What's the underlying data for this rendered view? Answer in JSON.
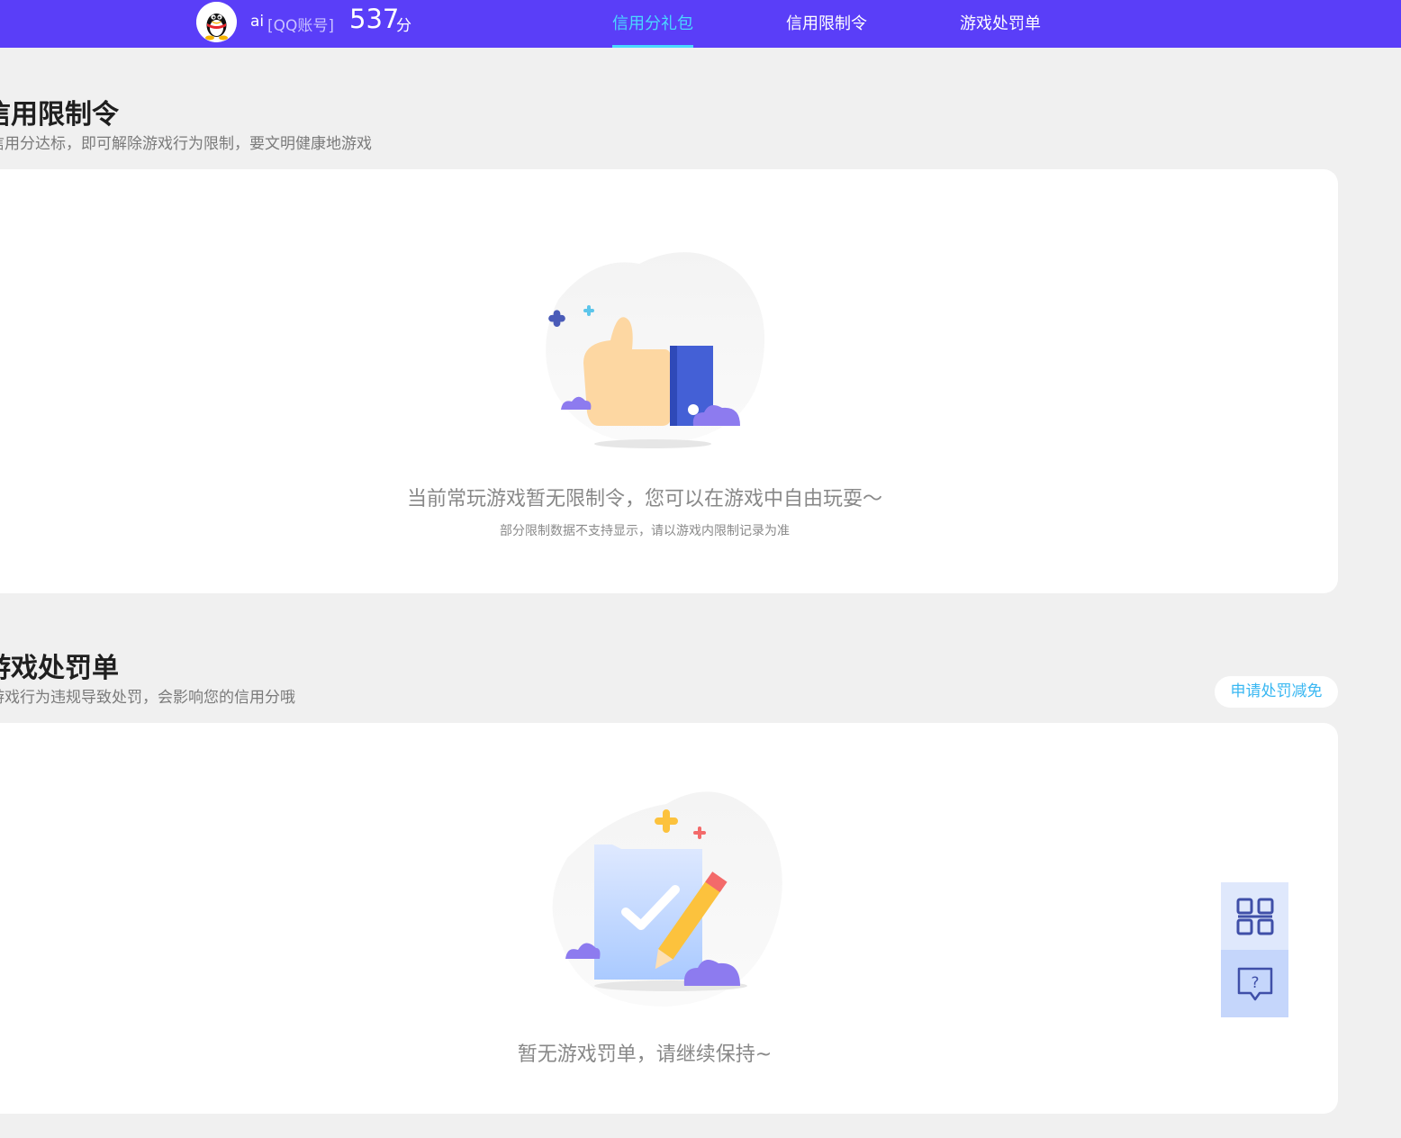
{
  "header": {
    "user_name": "ai",
    "account_type": "[QQ账号]",
    "score": "537",
    "score_unit": "分",
    "nav": [
      {
        "label": "信用分礼包",
        "active": true
      },
      {
        "label": "信用限制令",
        "active": false
      },
      {
        "label": "游戏处罚单",
        "active": false
      }
    ]
  },
  "restriction": {
    "title": "信用限制令",
    "desc": "信用分达标，即可解除游戏行为限制，要文明健康地游戏",
    "empty_main": "当前常玩游戏暂无限制令，您可以在游戏中自由玩耍～",
    "empty_sub": "部分限制数据不支持显示，请以游戏内限制记录为准"
  },
  "penalty": {
    "title": "游戏处罚单",
    "desc": "游戏行为违规导致处罚，会影响您的信用分哦",
    "appeal_label": "申请处罚减免",
    "empty_main": "暂无游戏罚单，请继续保持~"
  },
  "sidebar": {
    "qr_icon": "qr-code-icon",
    "help_icon": "help-chat-icon"
  },
  "colors": {
    "header_bg": "#5a3ef8",
    "nav_active": "#4ad8ff",
    "accent": "#38b7f2"
  }
}
